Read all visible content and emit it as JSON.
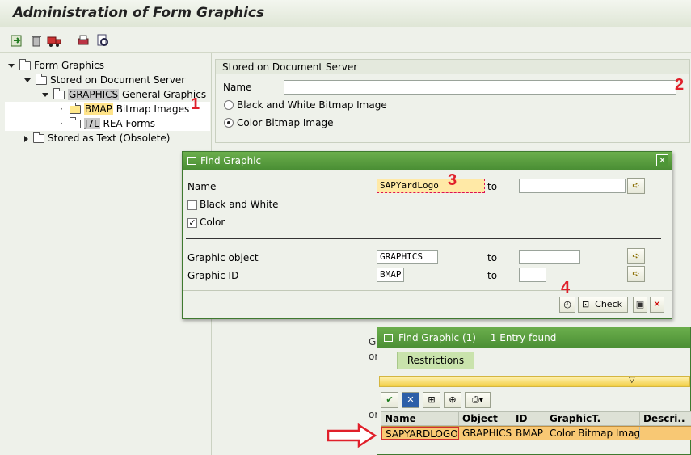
{
  "app": {
    "title": "Administration of Form Graphics"
  },
  "tree": {
    "root": "Form Graphics",
    "doc_server": "Stored on Document Server",
    "graphics_code": "GRAPHICS",
    "graphics_label": "General Graphics",
    "bmap_code": "BMAP",
    "bmap_label": "Bitmap Images",
    "j7l_code": "J7L",
    "j7l_label": "REA Forms",
    "as_text": "Stored as Text (Obsolete)"
  },
  "panel": {
    "header": "Stored on Document Server",
    "name_label": "Name",
    "name_value": "",
    "radio_bw": "Black and White Bitmap Image",
    "radio_color": "Color Bitmap Image"
  },
  "find": {
    "title": "Find Graphic",
    "name_label": "Name",
    "name_value": "SAPYardLogo",
    "to1": "to",
    "bw_label": "Black and White",
    "color_label": "Color",
    "object_label": "Graphic object",
    "object_value": "GRAPHICS",
    "to2": "to",
    "id_label": "Graphic ID",
    "id_value": "BMAP",
    "to3": "to",
    "check_label": "Check"
  },
  "results": {
    "title": "Find Graphic (1)",
    "count": "1 Entry found",
    "tab": "Restrictions",
    "columns": [
      "Name",
      "Object",
      "ID",
      "GraphicT.",
      "Descri..."
    ],
    "row": [
      "SAPYARDLOGO",
      "GRAPHICS",
      "BMAP",
      "Color Bitmap Image",
      ""
    ]
  },
  "annotations": [
    "1",
    "2",
    "3",
    "4"
  ],
  "colors": {
    "accent_red": "#e0202a",
    "dialog_green": "#4a8e34",
    "selection_orange": "#f8c874"
  }
}
